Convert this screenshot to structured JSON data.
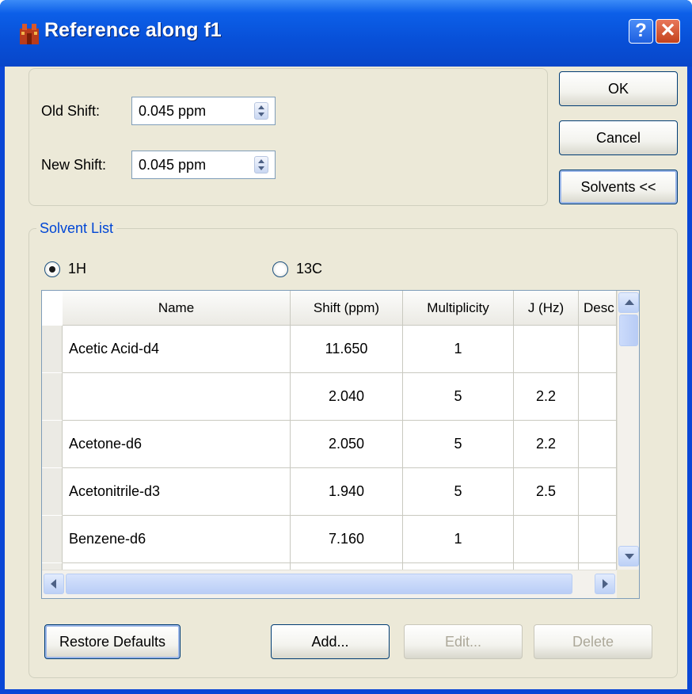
{
  "window": {
    "title": "Reference along f1"
  },
  "shift": {
    "old_label": "Old Shift:",
    "old_value": "0.045 ppm",
    "new_label": "New Shift:",
    "new_value": "0.045 ppm"
  },
  "buttons": {
    "ok": "OK",
    "cancel": "Cancel",
    "solvents": "Solvents <<",
    "restore": "Restore Defaults",
    "add": "Add...",
    "edit": "Edit...",
    "delete": "Delete"
  },
  "solvent_list": {
    "legend": "Solvent List",
    "nuclei": [
      {
        "label": "1H",
        "selected": true
      },
      {
        "label": "13C",
        "selected": false
      }
    ],
    "columns": [
      "Name",
      "Shift (ppm)",
      "Multiplicity",
      "J (Hz)",
      "Desc"
    ],
    "rows": [
      [
        "Acetic Acid-d4",
        "11.650",
        "1",
        ""
      ],
      [
        "",
        "2.040",
        "5",
        "2.2"
      ],
      [
        "Acetone-d6",
        "2.050",
        "5",
        "2.2"
      ],
      [
        "Acetonitrile-d3",
        "1.940",
        "5",
        "2.5"
      ],
      [
        "Benzene-d6",
        "7.160",
        "1",
        ""
      ]
    ]
  },
  "colors": {
    "title_bar": "#0850d8",
    "group_label": "#0046d5",
    "dialog_bg": "#ece9d8"
  }
}
